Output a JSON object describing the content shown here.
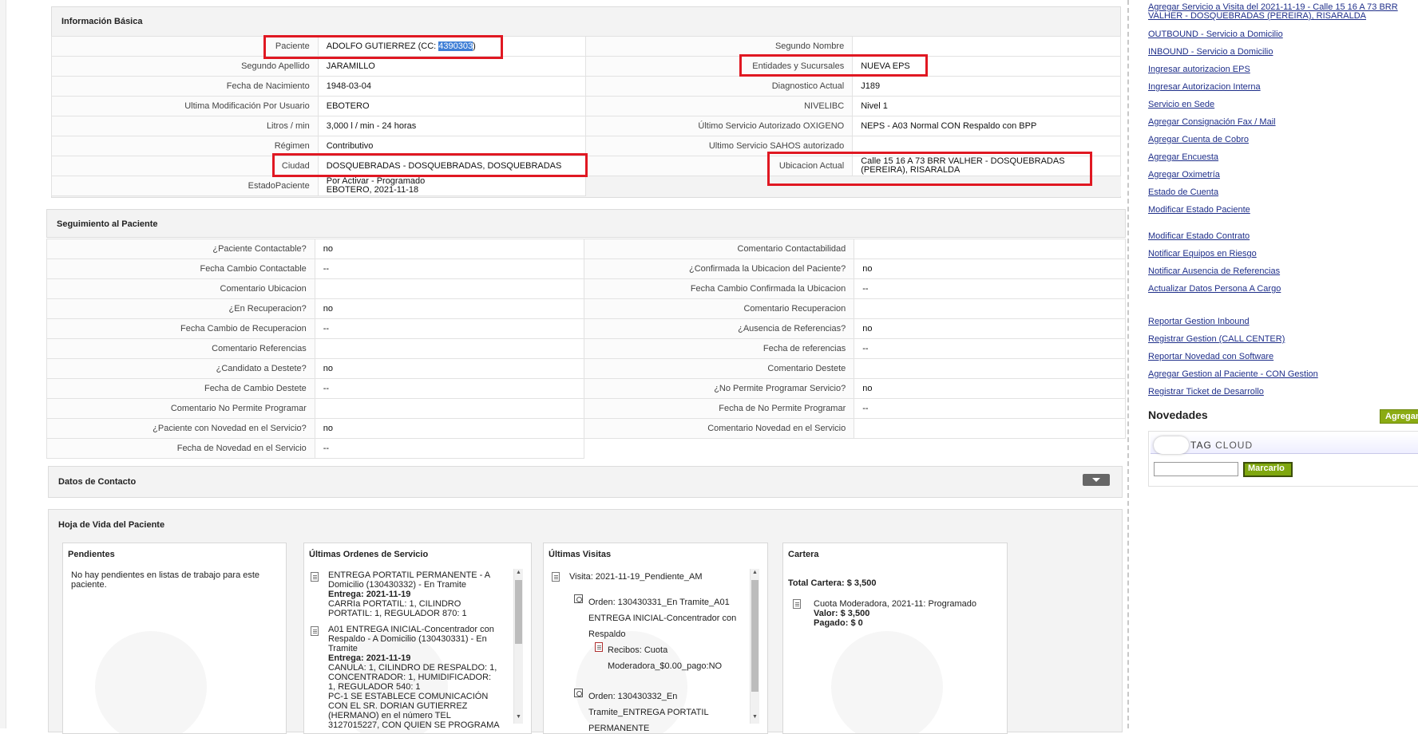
{
  "basic_info": {
    "title": "Información Básica",
    "rows": [
      {
        "l1": "Paciente",
        "v1_prefix": "ADOLFO GUTIERREZ (CC: ",
        "v1_highlight": "4390303",
        "v1_suffix": ")",
        "l2": "Segundo Nombre",
        "v2": ""
      },
      {
        "l1": "Segundo Apellido",
        "v1": "JARAMILLO",
        "l2": "Entidades y Sucursales",
        "v2": "NUEVA EPS"
      },
      {
        "l1": "Fecha de Nacimiento",
        "v1": "1948-03-04",
        "l2": "Diagnostico Actual",
        "v2": "J189"
      },
      {
        "l1": "Ultima Modificación Por Usuario",
        "v1": "EBOTERO",
        "l2": "NIVELIBC",
        "v2": "Nivel 1"
      },
      {
        "l1": "Litros / min",
        "v1": "3,000 l / min - 24 horas",
        "l2": "Último Servicio Autorizado OXIGENO",
        "v2": "NEPS - A03 Normal CON Respaldo con BPP"
      },
      {
        "l1": "Régimen",
        "v1": "Contributivo",
        "l2": "Ultimo Servicio SAHOS autorizado",
        "v2": ""
      },
      {
        "l1": "Ciudad",
        "v1": "DOSQUEBRADAS - DOSQUEBRADAS, DOSQUEBRADAS",
        "l2": "Ubicacion Actual",
        "v2_line1": "Calle 15 16 A 73 BRR VALHER - DOSQUEBRADAS",
        "v2_line2": "(PEREIRA), RISARALDA"
      },
      {
        "l1": "EstadoPaciente",
        "v1_line1": "Por Activar - Programado",
        "v1_line2": "EBOTERO, 2021-11-18"
      }
    ]
  },
  "follow_up": {
    "title": "Seguimiento al Paciente",
    "rows": [
      {
        "l1": "¿Paciente Contactable?",
        "v1": "no",
        "l2": "Comentario Contactabilidad",
        "v2": ""
      },
      {
        "l1": "Fecha Cambio Contactable",
        "v1": "--",
        "l2": "¿Confirmada la Ubicacion del Paciente?",
        "v2": "no"
      },
      {
        "l1": "Comentario Ubicacion",
        "v1": "",
        "l2": "Fecha Cambio Confirmada la Ubicacion",
        "v2": "--"
      },
      {
        "l1": "¿En Recuperacion?",
        "v1": "no",
        "l2": "Comentario Recuperacion",
        "v2": ""
      },
      {
        "l1": "Fecha Cambio de Recuperacion",
        "v1": "--",
        "l2": "¿Ausencia de Referencias?",
        "v2": "no"
      },
      {
        "l1": "Comentario Referencias",
        "v1": "",
        "l2": "Fecha de referencias",
        "v2": "--"
      },
      {
        "l1": "¿Candidato a Destete?",
        "v1": "no",
        "l2": "Comentario Destete",
        "v2": ""
      },
      {
        "l1": "Fecha de Cambio Destete",
        "v1": "--",
        "l2": "¿No Permite Programar Servicio?",
        "v2": "no"
      },
      {
        "l1": "Comentario No Permite Programar",
        "v1": "",
        "l2": "Fecha de No Permite Programar",
        "v2": "--"
      },
      {
        "l1": "¿Paciente con Novedad en el Servicio?",
        "v1": "no",
        "l2": "Comentario Novedad en el Servicio",
        "v2": ""
      },
      {
        "l1": "Fecha de Novedad en el Servicio",
        "v1": "--"
      }
    ]
  },
  "contact": {
    "title": "Datos de Contacto"
  },
  "life": {
    "title": "Hoja de Vida del Paciente",
    "pending": {
      "title": "Pendientes",
      "text_line1": "No hay pendientes en listas de trabajo para este",
      "text_line2": "paciente."
    },
    "orders": {
      "title": "Últimas Ordenes de Servicio",
      "o1": {
        "l1": "ENTREGA PORTATIL PERMANENTE - A",
        "l2": "Domicilio (130430332) - En Tramite",
        "entrega_label": "Entrega:",
        "entrega": "2021-11-19",
        "l4": "CARRIa PORTATIL: 1, CILINDRO",
        "l5": "PORTATIL: 1, REGULADOR 870: 1"
      },
      "o2": {
        "l1": "A01 ENTREGA INICIAL-Concentrador con",
        "l2": "Respaldo - A Domicilio (130430331) - En",
        "l3": "Tramite",
        "entrega_label": "Entrega:",
        "entrega": "2021-11-19",
        "l5": "CANULA: 1, CILINDRO DE RESPALDO: 1,",
        "l6": "CONCENTRADOR: 1, HUMIDIFICADOR:",
        "l7": "1, REGULADOR 540: 1",
        "l8": "PC-1 SE ESTABLECE COMUNICACIÓN",
        "l9": "CON EL SR. DORIAN GUTIERREZ",
        "l10": "(HERMANO) en el número TEL",
        "l11": "3127015227, CON QUIEN SE PROGRAMA"
      }
    },
    "visits": {
      "title": "Últimas Visitas",
      "visit": "Visita: 2021-11-19_Pendiente_AM",
      "ord1_l1": "Orden: 130430331_En Tramite_A01",
      "ord1_l2": "ENTREGA INICIAL-Concentrador con",
      "ord1_l3": "Respaldo",
      "rec_l1": "Recibos: Cuota",
      "rec_l2": "Moderadora_$0.00_pago:NO",
      "ord2_l1": "Orden: 130430332_En",
      "ord2_l2": "Tramite_ENTREGA PORTATIL",
      "ord2_l3": "PERMANENTE"
    },
    "wallet": {
      "title": "Cartera",
      "total": "Total Cartera: $ 3,500",
      "item": "Cuota Moderadora, 2021-11: Programado",
      "valor": "Valor: $ 3,500",
      "pagado": "Pagado: $ 0"
    }
  },
  "right_menu": {
    "top_link_line1": "Agregar Servicio a Visita del 2021-11-19 - Calle 15 16 A 73 BRR",
    "top_link_line2": "VALHER - DOSQUEBRADAS (PEREIRA), RISARALDA",
    "group1": [
      "OUTBOUND - Servicio a Domicilio",
      "INBOUND - Servicio a Domicilio",
      "Ingresar autorizacion EPS",
      "Ingresar Autorizacion Interna",
      "Servicio en Sede",
      "Agregar Consignación Fax / Mail",
      "Agregar Cuenta de Cobro",
      "Agregar Encuesta",
      "Agregar Oximetría",
      "Estado de Cuenta",
      "Modificar Estado Paciente"
    ],
    "group2": [
      "Modificar Estado Contrato",
      "Notificar Equipos en Riesgo",
      "Notificar Ausencia de Referencias",
      "Actualizar Datos Persona A Cargo"
    ],
    "group3": [
      "Reportar Gestion Inbound",
      "Registrar Gestion (CALL CENTER)",
      "Reportar Novedad con Software",
      "Agregar Gestion al Paciente - CON Gestion",
      "Registrar Ticket de Desarrollo"
    ],
    "novedades": "Novedades",
    "agregar": "Agregar",
    "tag_cloud_a": "TAG",
    "tag_cloud_b": "CLOUD",
    "marcarlo": "Marcarlo"
  }
}
